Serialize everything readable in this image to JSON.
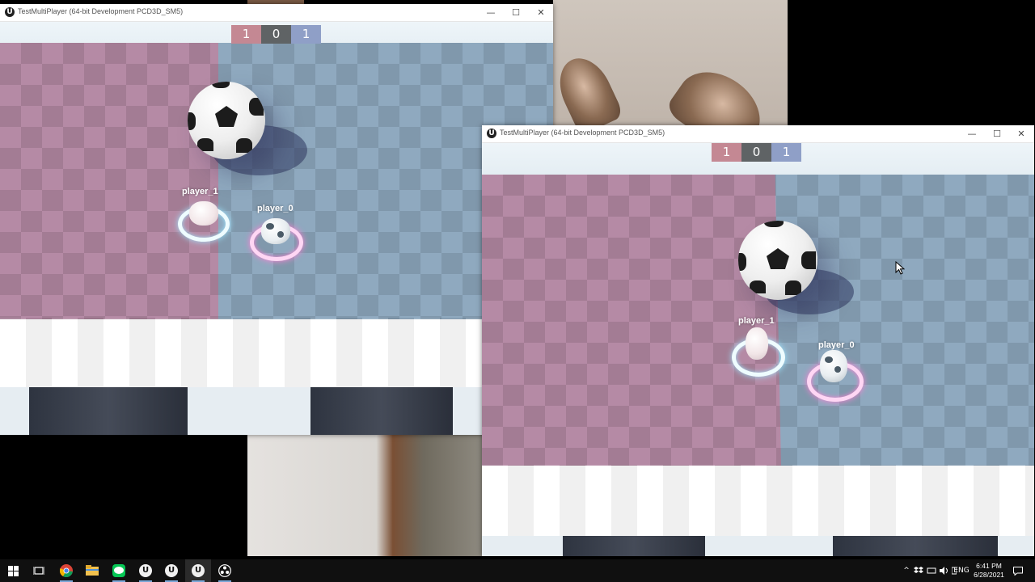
{
  "windows": [
    {
      "title": "TestMultiPlayer (64-bit Development PCD3D_SM5)",
      "scores": [
        "1",
        "0",
        "1"
      ],
      "players": [
        "player_1",
        "player_0"
      ]
    },
    {
      "title": "TestMultiPlayer (64-bit Development PCD3D_SM5)",
      "scores": [
        "1",
        "0",
        "1"
      ],
      "players": [
        "player_1",
        "player_0"
      ]
    }
  ],
  "window_controls": {
    "minimize": "—",
    "maximize": "☐",
    "close": "✕"
  },
  "taskbar": {
    "apps": [
      "windows-start",
      "task-view",
      "chrome",
      "file-explorer",
      "line",
      "unreal-engine",
      "unreal-engine",
      "unreal-engine",
      "obs"
    ],
    "ue_glyph": "U",
    "tray": {
      "chevron": "^",
      "language": "ENG",
      "time": "6:41 PM",
      "date": "6/28/2021"
    }
  },
  "colors": {
    "team_red": "#c48893",
    "team_neutral": "#5f6365",
    "team_blue": "#8f9fc7",
    "ring_player_1": "#eefcff",
    "ring_player_0": "#ff7fd3"
  }
}
